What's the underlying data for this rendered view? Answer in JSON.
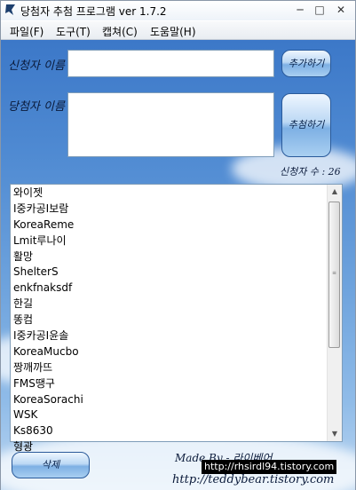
{
  "window": {
    "title": "당첨자 추첨 프로그램 ver 1.7.2",
    "controls": {
      "minimize": "─",
      "restore": "□",
      "close": "✕"
    }
  },
  "menu": [
    {
      "label": "파일(F)"
    },
    {
      "label": "도구(T)"
    },
    {
      "label": "캡쳐(C)"
    },
    {
      "label": "도움말(H)"
    }
  ],
  "form": {
    "applicant_label": "신청자 이름",
    "applicant_value": "",
    "add_button": "추가하기",
    "winner_label": "당첨자 이름",
    "winner_value": "",
    "draw_button": "추첨하기",
    "count_label": "신청자 수 : 26"
  },
  "applicants": [
    "와이젯",
    "I중카공I보람",
    "KoreaReme",
    "Lmit루나이",
    "활망",
    "ShelterS",
    "enkfnaksdf",
    "한길",
    "똥컴",
    "I중카공I윤솔",
    "KoreaMucbo",
    "짱깨까뜨",
    "FMS땡구",
    "KoreaSorachi",
    "WSK",
    "Ks8630",
    "형광"
  ],
  "footer": {
    "delete_button": "삭제",
    "made_by": "Made By - 라이베어",
    "url_tooltip": "http://rhsirdl94.tistory.com",
    "url_handwritten": "http://teddybear.tistory.com"
  },
  "icons": {
    "app": "bear-icon"
  },
  "colors": {
    "background_top": "#3c78c8",
    "background_bottom": "#bcd7f1",
    "button_border": "#2a5a9a"
  }
}
